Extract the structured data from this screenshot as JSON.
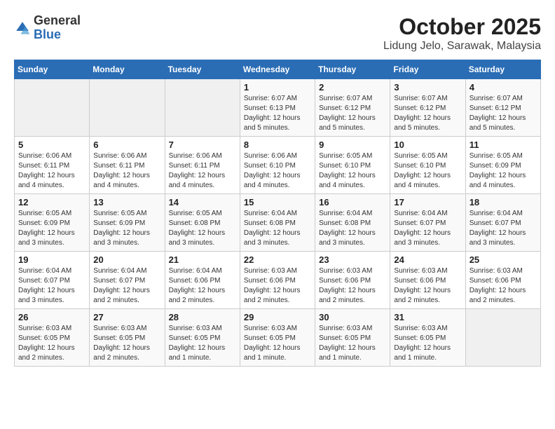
{
  "header": {
    "logo_general": "General",
    "logo_blue": "Blue",
    "month_title": "October 2025",
    "location": "Lidung Jelo, Sarawak, Malaysia"
  },
  "weekdays": [
    "Sunday",
    "Monday",
    "Tuesday",
    "Wednesday",
    "Thursday",
    "Friday",
    "Saturday"
  ],
  "weeks": [
    [
      {
        "day": "",
        "info": ""
      },
      {
        "day": "",
        "info": ""
      },
      {
        "day": "",
        "info": ""
      },
      {
        "day": "1",
        "info": "Sunrise: 6:07 AM\nSunset: 6:13 PM\nDaylight: 12 hours\nand 5 minutes."
      },
      {
        "day": "2",
        "info": "Sunrise: 6:07 AM\nSunset: 6:12 PM\nDaylight: 12 hours\nand 5 minutes."
      },
      {
        "day": "3",
        "info": "Sunrise: 6:07 AM\nSunset: 6:12 PM\nDaylight: 12 hours\nand 5 minutes."
      },
      {
        "day": "4",
        "info": "Sunrise: 6:07 AM\nSunset: 6:12 PM\nDaylight: 12 hours\nand 5 minutes."
      }
    ],
    [
      {
        "day": "5",
        "info": "Sunrise: 6:06 AM\nSunset: 6:11 PM\nDaylight: 12 hours\nand 4 minutes."
      },
      {
        "day": "6",
        "info": "Sunrise: 6:06 AM\nSunset: 6:11 PM\nDaylight: 12 hours\nand 4 minutes."
      },
      {
        "day": "7",
        "info": "Sunrise: 6:06 AM\nSunset: 6:11 PM\nDaylight: 12 hours\nand 4 minutes."
      },
      {
        "day": "8",
        "info": "Sunrise: 6:06 AM\nSunset: 6:10 PM\nDaylight: 12 hours\nand 4 minutes."
      },
      {
        "day": "9",
        "info": "Sunrise: 6:05 AM\nSunset: 6:10 PM\nDaylight: 12 hours\nand 4 minutes."
      },
      {
        "day": "10",
        "info": "Sunrise: 6:05 AM\nSunset: 6:10 PM\nDaylight: 12 hours\nand 4 minutes."
      },
      {
        "day": "11",
        "info": "Sunrise: 6:05 AM\nSunset: 6:09 PM\nDaylight: 12 hours\nand 4 minutes."
      }
    ],
    [
      {
        "day": "12",
        "info": "Sunrise: 6:05 AM\nSunset: 6:09 PM\nDaylight: 12 hours\nand 3 minutes."
      },
      {
        "day": "13",
        "info": "Sunrise: 6:05 AM\nSunset: 6:09 PM\nDaylight: 12 hours\nand 3 minutes."
      },
      {
        "day": "14",
        "info": "Sunrise: 6:05 AM\nSunset: 6:08 PM\nDaylight: 12 hours\nand 3 minutes."
      },
      {
        "day": "15",
        "info": "Sunrise: 6:04 AM\nSunset: 6:08 PM\nDaylight: 12 hours\nand 3 minutes."
      },
      {
        "day": "16",
        "info": "Sunrise: 6:04 AM\nSunset: 6:08 PM\nDaylight: 12 hours\nand 3 minutes."
      },
      {
        "day": "17",
        "info": "Sunrise: 6:04 AM\nSunset: 6:07 PM\nDaylight: 12 hours\nand 3 minutes."
      },
      {
        "day": "18",
        "info": "Sunrise: 6:04 AM\nSunset: 6:07 PM\nDaylight: 12 hours\nand 3 minutes."
      }
    ],
    [
      {
        "day": "19",
        "info": "Sunrise: 6:04 AM\nSunset: 6:07 PM\nDaylight: 12 hours\nand 3 minutes."
      },
      {
        "day": "20",
        "info": "Sunrise: 6:04 AM\nSunset: 6:07 PM\nDaylight: 12 hours\nand 2 minutes."
      },
      {
        "day": "21",
        "info": "Sunrise: 6:04 AM\nSunset: 6:06 PM\nDaylight: 12 hours\nand 2 minutes."
      },
      {
        "day": "22",
        "info": "Sunrise: 6:03 AM\nSunset: 6:06 PM\nDaylight: 12 hours\nand 2 minutes."
      },
      {
        "day": "23",
        "info": "Sunrise: 6:03 AM\nSunset: 6:06 PM\nDaylight: 12 hours\nand 2 minutes."
      },
      {
        "day": "24",
        "info": "Sunrise: 6:03 AM\nSunset: 6:06 PM\nDaylight: 12 hours\nand 2 minutes."
      },
      {
        "day": "25",
        "info": "Sunrise: 6:03 AM\nSunset: 6:06 PM\nDaylight: 12 hours\nand 2 minutes."
      }
    ],
    [
      {
        "day": "26",
        "info": "Sunrise: 6:03 AM\nSunset: 6:05 PM\nDaylight: 12 hours\nand 2 minutes."
      },
      {
        "day": "27",
        "info": "Sunrise: 6:03 AM\nSunset: 6:05 PM\nDaylight: 12 hours\nand 2 minutes."
      },
      {
        "day": "28",
        "info": "Sunrise: 6:03 AM\nSunset: 6:05 PM\nDaylight: 12 hours\nand 1 minute."
      },
      {
        "day": "29",
        "info": "Sunrise: 6:03 AM\nSunset: 6:05 PM\nDaylight: 12 hours\nand 1 minute."
      },
      {
        "day": "30",
        "info": "Sunrise: 6:03 AM\nSunset: 6:05 PM\nDaylight: 12 hours\nand 1 minute."
      },
      {
        "day": "31",
        "info": "Sunrise: 6:03 AM\nSunset: 6:05 PM\nDaylight: 12 hours\nand 1 minute."
      },
      {
        "day": "",
        "info": ""
      }
    ]
  ]
}
